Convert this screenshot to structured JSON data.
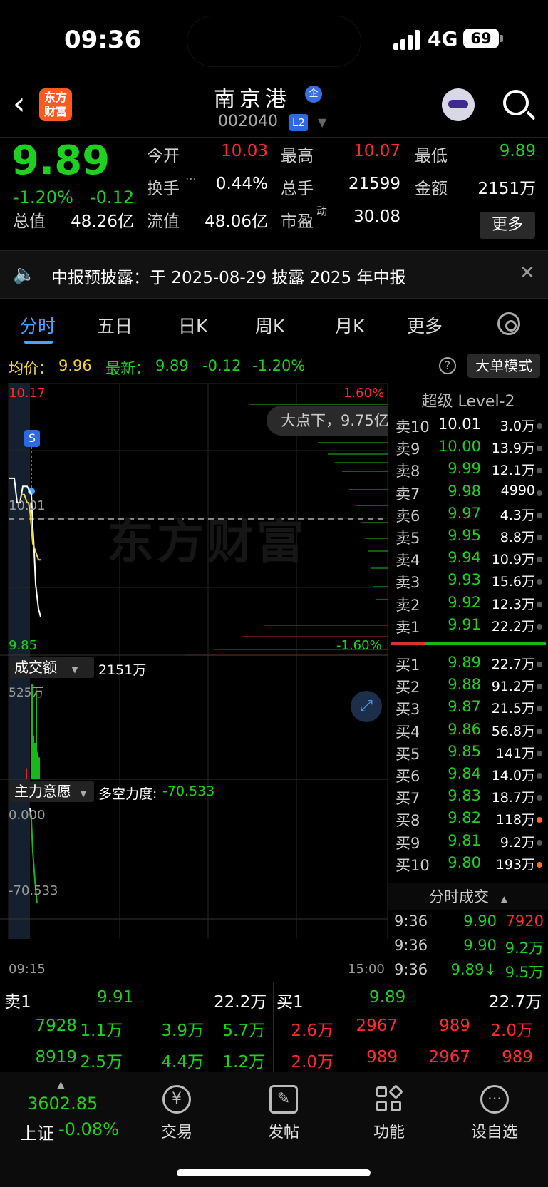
{
  "status": {
    "time": "09:36",
    "network": "4G",
    "battery": "69"
  },
  "header": {
    "logo_text": "东方财富",
    "stock_name": "南京港",
    "badge": "企",
    "code": "002040",
    "level_badge": "L2"
  },
  "quote": {
    "price": "9.89",
    "pct": "-1.20%",
    "change": "-0.12",
    "open_label": "今开",
    "open": "10.03",
    "high_label": "最高",
    "high": "10.07",
    "low_label": "最低",
    "low": "9.89",
    "turnover_label": "换手",
    "turnover": "0.44%",
    "vol_label": "总手",
    "volume": "21599",
    "amount_label": "金额",
    "amount": "2151万",
    "mcap_label": "总值",
    "mcap": "48.26亿",
    "float_label": "流值",
    "float": "48.06亿",
    "pe_label": "市盈",
    "pe_sup": "动",
    "pe": "30.08",
    "more": "更多"
  },
  "notice": {
    "text": "中报预披露：于 2025-08-29 披露 2025 年中报"
  },
  "tabs": [
    "分时",
    "五日",
    "日K",
    "周K",
    "月K",
    "更多"
  ],
  "info": {
    "avg_label": "均价：",
    "avg": "9.96",
    "latest_label": "最新：",
    "latest": "9.89",
    "latest_chg": "-0.12",
    "latest_pct": "-1.20%",
    "mode": "大单模式",
    "help": "?"
  },
  "chart_data": [
    {
      "type": "line",
      "title": "",
      "y_top": "10.17",
      "y_mid": "10.01",
      "y_bottom": "9.85",
      "pct_top": "1.60%",
      "pct_bottom": "-1.60%",
      "ylim": [
        9.85,
        10.17
      ],
      "prev_close": 10.01,
      "marker": "S",
      "tooltip": "大点下，9.75亿",
      "series": [
        {
          "values": [
            10.06,
            10.06,
            10.03,
            10.03,
            10.05,
            10.05,
            10.04,
            10.0,
            9.97,
            9.93,
            9.9,
            9.89
          ]
        },
        {
          "values": [
            10.04,
            10.04,
            10.03,
            10.03,
            10.02,
            10.0,
            9.98,
            9.97,
            9.96,
            9.96
          ]
        }
      ],
      "x_start": "09:15",
      "x_end": "15:00"
    },
    {
      "type": "bar",
      "label": "成交额",
      "total": "2151万",
      "ymax_label": "525万",
      "values": [
        60,
        525,
        240,
        200,
        480,
        150,
        120
      ]
    },
    {
      "type": "line",
      "label": "主力意愿",
      "indicator_label": "多空力度:",
      "indicator": "-70.533",
      "y_top": "0.000",
      "y_bottom": "-70.533",
      "values": [
        0,
        -5,
        -30,
        -45,
        -60,
        -70.533
      ]
    }
  ],
  "orderbook": {
    "title": "超级 Level-2",
    "sells": [
      {
        "label": "卖10",
        "price": "10.01",
        "vol": "3.0万",
        "dot": ""
      },
      {
        "label": "卖9",
        "price": "10.00",
        "vol": "13.9万",
        "dot": ""
      },
      {
        "label": "卖8",
        "price": "9.99",
        "vol": "12.1万",
        "dot": ""
      },
      {
        "label": "卖7",
        "price": "9.98",
        "vol": "4990",
        "dot": ""
      },
      {
        "label": "卖6",
        "price": "9.97",
        "vol": "4.3万",
        "dot": ""
      },
      {
        "label": "卖5",
        "price": "9.95",
        "vol": "8.8万",
        "dot": ""
      },
      {
        "label": "卖4",
        "price": "9.94",
        "vol": "10.9万",
        "dot": ""
      },
      {
        "label": "卖3",
        "price": "9.93",
        "vol": "15.6万",
        "dot": ""
      },
      {
        "label": "卖2",
        "price": "9.92",
        "vol": "12.3万",
        "dot": ""
      },
      {
        "label": "卖1",
        "price": "9.91",
        "vol": "22.2万",
        "dot": ""
      }
    ],
    "buys": [
      {
        "label": "买1",
        "price": "9.89",
        "vol": "22.7万",
        "dot": ""
      },
      {
        "label": "买2",
        "price": "9.88",
        "vol": "91.2万",
        "dot": ""
      },
      {
        "label": "买3",
        "price": "9.87",
        "vol": "21.5万",
        "dot": ""
      },
      {
        "label": "买4",
        "price": "9.86",
        "vol": "56.8万",
        "dot": ""
      },
      {
        "label": "买5",
        "price": "9.85",
        "vol": "141万",
        "dot": ""
      },
      {
        "label": "买6",
        "price": "9.84",
        "vol": "14.0万",
        "dot": ""
      },
      {
        "label": "买7",
        "price": "9.83",
        "vol": "18.7万",
        "dot": ""
      },
      {
        "label": "买8",
        "price": "9.82",
        "vol": "118万",
        "dot": "o"
      },
      {
        "label": "买9",
        "price": "9.81",
        "vol": "9.2万",
        "dot": ""
      },
      {
        "label": "买10",
        "price": "9.80",
        "vol": "193万",
        "dot": "o"
      }
    ]
  },
  "ticks": {
    "title": "分时成交",
    "rows": [
      {
        "time": "9:36",
        "price": "9.90",
        "vol": "7920",
        "vc": "r"
      },
      {
        "time": "9:36",
        "price": "9.90",
        "vol": "9.2万",
        "vc": "g"
      },
      {
        "time": "9:36",
        "price": "9.89↓",
        "vol": "9.5万",
        "vc": "g"
      }
    ]
  },
  "bottom": {
    "sell_label": "卖1",
    "sell_price": "9.91",
    "sell_vol": "22.2万",
    "buy_label": "买1",
    "buy_price": "9.89",
    "buy_vol": "22.7万",
    "sell_q1": [
      "7928",
      "1.1万",
      "3.9万",
      "5.7万"
    ],
    "sell_q2": [
      "8919",
      "2.5万",
      "4.4万",
      "1.2万"
    ],
    "buy_q1": [
      "2.6万",
      "2967",
      "989",
      "2.0万"
    ],
    "buy_q2": [
      "2.0万",
      "989",
      "2967",
      "989"
    ]
  },
  "nav": {
    "index": "3602.85",
    "index_name": "上证",
    "index_pct": "-0.08%",
    "items": [
      "交易",
      "发帖",
      "功能",
      "设自选"
    ]
  }
}
